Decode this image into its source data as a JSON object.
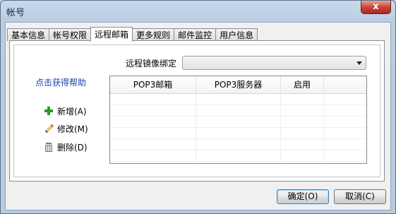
{
  "window": {
    "title": "帐号",
    "close_label": "x"
  },
  "tabs": [
    {
      "label": "基本信息",
      "active": false
    },
    {
      "label": "帐号权限",
      "active": false
    },
    {
      "label": "远程邮箱",
      "active": true
    },
    {
      "label": "更多规则",
      "active": false
    },
    {
      "label": "邮件监控",
      "active": false
    },
    {
      "label": "用户信息",
      "active": false
    }
  ],
  "help": {
    "link_text": "点击获得帮助",
    "logo_glyph": "y"
  },
  "actions": {
    "add": "新增(A)",
    "edit": "修改(M)",
    "delete": "删除(D)"
  },
  "mirror": {
    "label": "远程镜像绑定",
    "selected": ""
  },
  "table": {
    "columns": [
      "POP3邮箱",
      "POP3服务器",
      "启用"
    ],
    "rows": []
  },
  "buttons": {
    "ok": "确定(O)",
    "cancel": "取消(C)"
  },
  "colors": {
    "link": "#1f3fa8",
    "plus_icon": "#2a9a24",
    "close_button": "#c6463a"
  }
}
